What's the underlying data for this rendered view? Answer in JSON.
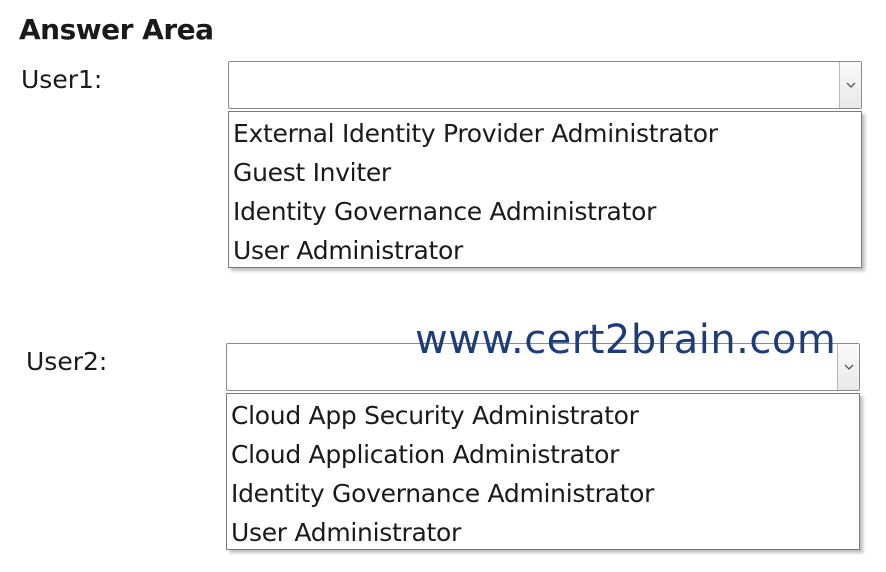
{
  "heading": "Answer Area",
  "questions": [
    {
      "label": "User1:",
      "selected": "",
      "options": [
        "External Identity Provider Administrator",
        "Guest Inviter",
        "Identity Governance Administrator",
        "User Administrator"
      ]
    },
    {
      "label": "User2:",
      "selected": "",
      "options": [
        "Cloud App Security Administrator",
        "Cloud Application Administrator",
        "Identity Governance Administrator",
        "User Administrator"
      ]
    }
  ],
  "watermark": "www.cert2brain.com",
  "icons": {
    "dropdown": "chevron-down-icon"
  }
}
